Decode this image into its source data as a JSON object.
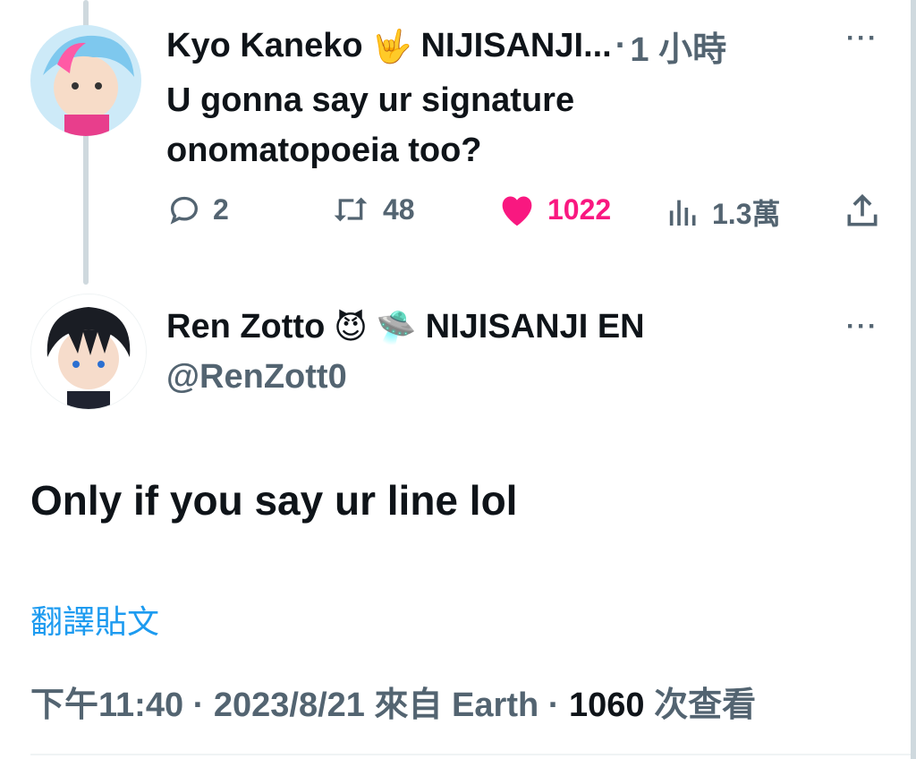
{
  "reply": {
    "author_name": "Kyo Kaneko",
    "author_emoji": "🤟",
    "author_org": "NIJISANJI...",
    "separator": "·",
    "time": "1 小時",
    "more": "···",
    "text": "U gonna say ur signature onomatopoeia too?",
    "actions": {
      "replies": "2",
      "reposts": "48",
      "likes": "1022",
      "views": "1.3萬"
    }
  },
  "main": {
    "author_name": "Ren Zotto",
    "author_emoji_1": "😈",
    "author_emoji_2": "🛸",
    "author_org": "NIJISANJI EN",
    "handle": "@RenZott0",
    "more": "···",
    "text": "Only if you say ur line lol",
    "translate": "翻譯貼文",
    "meta": {
      "time": "下午11:40",
      "sep1": " · ",
      "date": "2023/8/21",
      "source": " 來自 Earth",
      "sep2": " · ",
      "views_count": "1060",
      "views_label": " 次查看"
    }
  },
  "colors": {
    "text": "#0f1419",
    "secondary": "#536471",
    "like": "#f91880",
    "link": "#1d9bf0"
  },
  "icons": [
    "reply-icon",
    "repost-icon",
    "heart-icon",
    "views-icon",
    "share-icon",
    "more-icon"
  ]
}
